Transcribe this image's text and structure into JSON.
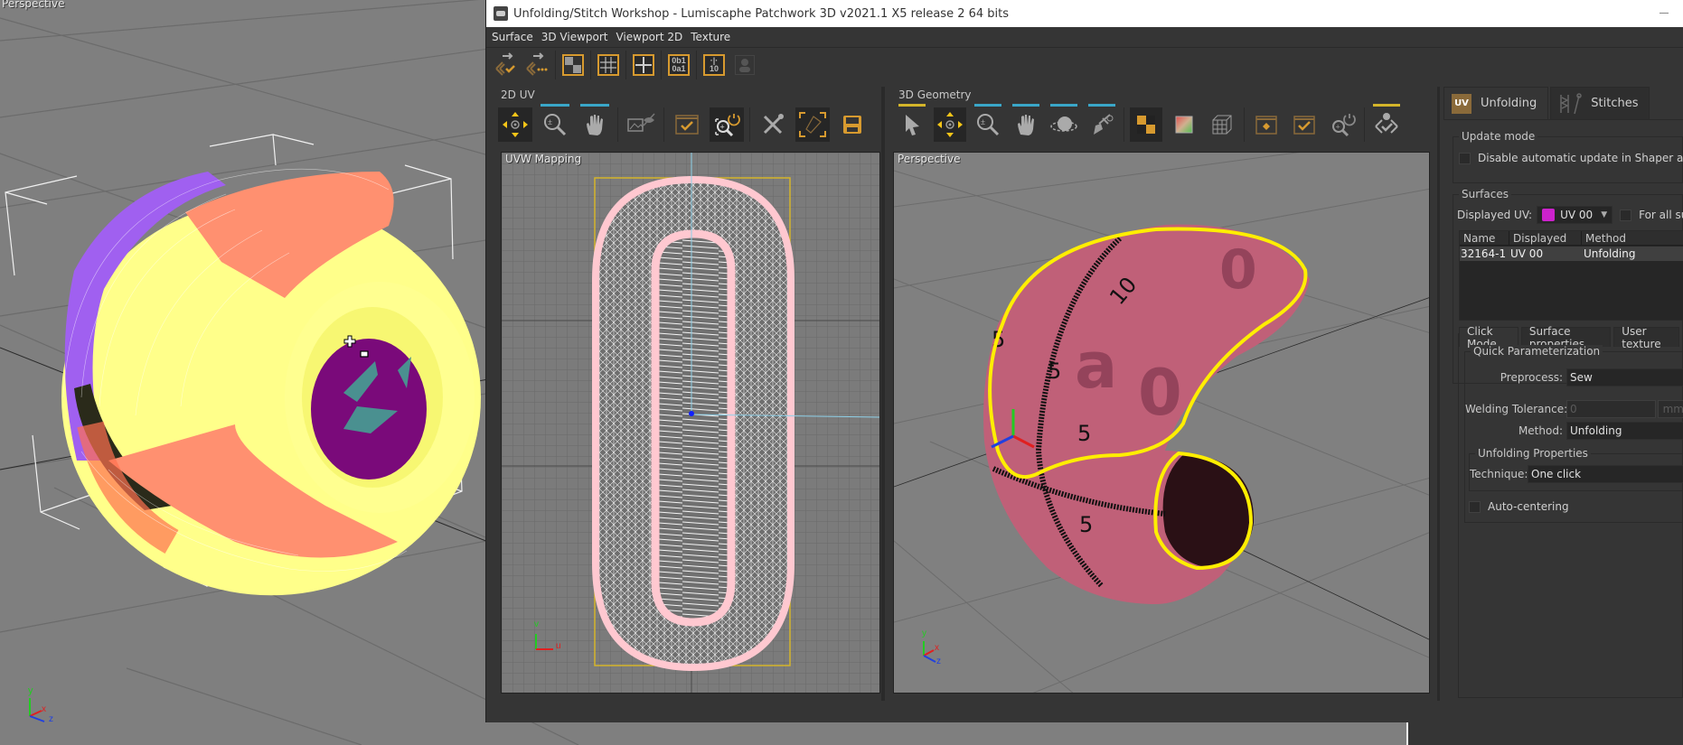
{
  "background_viewport": {
    "label": "Perspective",
    "axes": {
      "y": "y",
      "x": "x",
      "z": "z"
    }
  },
  "window": {
    "title": "Unfolding/Stitch Workshop - Lumiscaphe Patchwork 3D v2021.1 X5 release 2 64 bits",
    "minimize_icon": "minimize-icon"
  },
  "menubar": {
    "items": [
      "Surface",
      "3D Viewport",
      "Viewport 2D",
      "Texture"
    ]
  },
  "main_toolbar": {
    "buttons": [
      {
        "icon": "unfold-validate-icon"
      },
      {
        "icon": "unfold-pending-icon"
      },
      {
        "icon": "checker-texture-icon"
      },
      {
        "icon": "grid-icon"
      },
      {
        "icon": "crosshair-icon"
      },
      {
        "icon": "binary-label-icon",
        "text_top": "0b1",
        "text_bottom": "0a1"
      },
      {
        "icon": "ruler-label-icon",
        "text_top": "·|·",
        "text_bottom": "10"
      },
      {
        "icon": "user-icon"
      }
    ]
  },
  "uv_panel": {
    "title": "2D UV",
    "tools": [
      {
        "icon": "move-icon",
        "active": true
      },
      {
        "icon": "zoom-plus-minus-icon",
        "indicator": "blue"
      },
      {
        "icon": "pan-hand-icon",
        "indicator": "blue"
      },
      {
        "icon": "image-visibility-icon"
      },
      {
        "icon": "fit-selection-icon"
      },
      {
        "icon": "auto-zoom-icon",
        "active": true
      },
      {
        "icon": "tools-icon"
      },
      {
        "icon": "frame-uv-icon",
        "active": true
      },
      {
        "icon": "save-icon"
      }
    ],
    "viewport_label": "UVW Mapping",
    "axes": {
      "v": "v",
      "u": "u"
    }
  },
  "geometry_panel": {
    "title": "3D Geometry",
    "tools": [
      {
        "icon": "select-arrow-icon",
        "indicator": "yellow"
      },
      {
        "icon": "move-icon",
        "active": true
      },
      {
        "icon": "zoom-plus-minus-icon",
        "indicator": "blue"
      },
      {
        "icon": "pan-hand-icon",
        "indicator": "blue"
      },
      {
        "icon": "orbit-icon",
        "indicator": "blue"
      },
      {
        "icon": "pick-tool-icon",
        "indicator": "blue"
      },
      {
        "icon": "checker-material-icon",
        "active": true
      },
      {
        "icon": "gradient-material-icon"
      },
      {
        "icon": "wire-cube-icon"
      },
      {
        "icon": "fit-all-icon"
      },
      {
        "icon": "fit-selection-icon"
      },
      {
        "icon": "auto-zoom-icon"
      },
      {
        "icon": "stitch-validate-icon",
        "indicator": "yellow"
      }
    ],
    "viewport_label": "Perspective",
    "axes": {
      "y": "y",
      "x": "x",
      "z": "z"
    }
  },
  "side_panel": {
    "tabs": [
      {
        "label": "Unfolding",
        "badge": "UV",
        "active": true
      },
      {
        "label": "Stitches",
        "active": false
      }
    ],
    "update_mode": {
      "label": "Update mode",
      "disable_auto_update": {
        "label": "Disable automatic update in Shaper and Matter",
        "checked": false
      }
    },
    "surfaces": {
      "label": "Surfaces",
      "displayed_uv_label": "Displayed UV:",
      "displayed_uv_value": "UV 00",
      "for_all_surfaces": {
        "label": "For all surfaces",
        "checked": false
      },
      "table": {
        "columns": [
          "Name",
          "Displayed UV",
          "Method"
        ],
        "rows": [
          [
            "32164-1",
            "UV 00",
            "Unfolding"
          ]
        ]
      }
    },
    "sub_tabs": [
      {
        "label": "Click Mode",
        "active": true
      },
      {
        "label": "Surface properties",
        "active": false
      },
      {
        "label": "User texture",
        "active": false
      }
    ],
    "quick_param": {
      "label": "Quick Parameterization",
      "preprocess_label": "Preprocess:",
      "preprocess_value": "Sew",
      "welding_label": "Welding Tolerance:",
      "welding_value": "0",
      "welding_unit": "mm",
      "method_label": "Method:",
      "method_value": "Unfolding",
      "unfolding_props_label": "Unfolding Properties",
      "technique_label": "Technique:",
      "technique_value": "One click",
      "auto_centering": {
        "label": "Auto-centering",
        "checked": false
      }
    }
  },
  "colors": {
    "accent_orange": "#d79a2f",
    "indicator_blue": "#3aa6c8",
    "indicator_yellow": "#d4b52a",
    "selection_yellow": "#ffee00",
    "uv_pink": "#ffc8d0",
    "mesh_pink": "#c06078"
  }
}
